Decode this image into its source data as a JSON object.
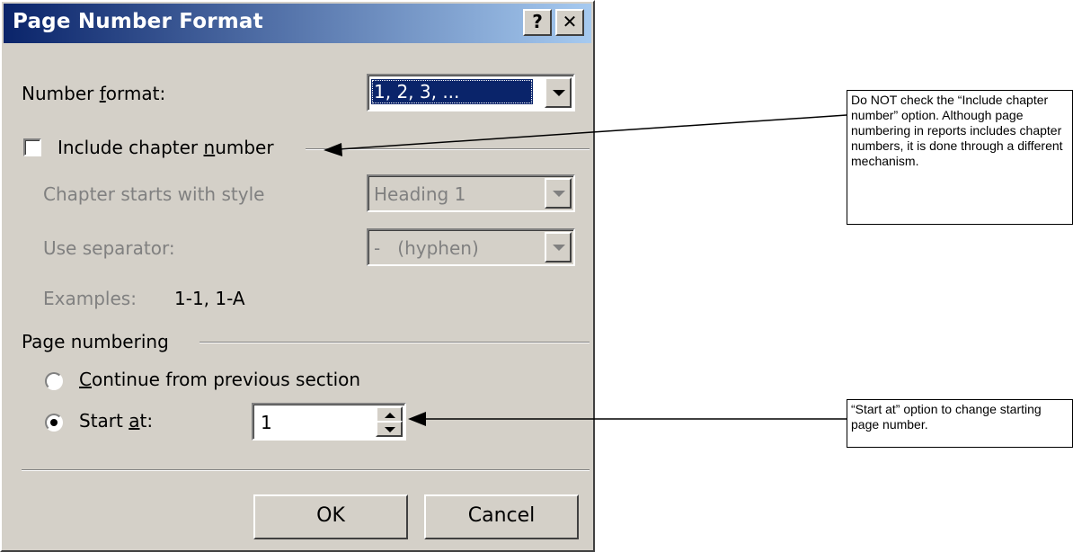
{
  "dialog": {
    "title": "Page Number Format",
    "help_label": "?",
    "close_label": "✕",
    "number_format": {
      "label_pre": "Number ",
      "label_key": "f",
      "label_post": "ormat:",
      "value": "1, 2, 3, ..."
    },
    "include_chapter": {
      "label_pre": "Include chapter ",
      "label_key": "n",
      "label_post": "umber",
      "checked": false
    },
    "chapter_style": {
      "label": "Chapter starts with style",
      "value": "Heading 1"
    },
    "separator": {
      "label": "Use separator:",
      "value": "-   (hyphen)"
    },
    "examples": {
      "label": "Examples:",
      "value": "1-1, 1-A"
    },
    "page_numbering": {
      "group_label": "Page numbering",
      "continue_key": "C",
      "continue_rest": "ontinue from previous section",
      "start_pre": "Start ",
      "start_key": "a",
      "start_post": "t:",
      "start_value": "1",
      "selected": "start"
    },
    "ok_label": "OK",
    "cancel_label": "Cancel"
  },
  "annotations": {
    "note1": "Do NOT check the “Include chapter number” option. Although page numbering in reports includes chapter numbers, it is done through a different mechanism.",
    "note2": "“Start at” option to change starting page number."
  },
  "colors": {
    "dialog_face": "#d4d0c8",
    "title_gradient_start": "#0a246a",
    "title_gradient_end": "#a6caf0",
    "selection": "#0a246a"
  }
}
